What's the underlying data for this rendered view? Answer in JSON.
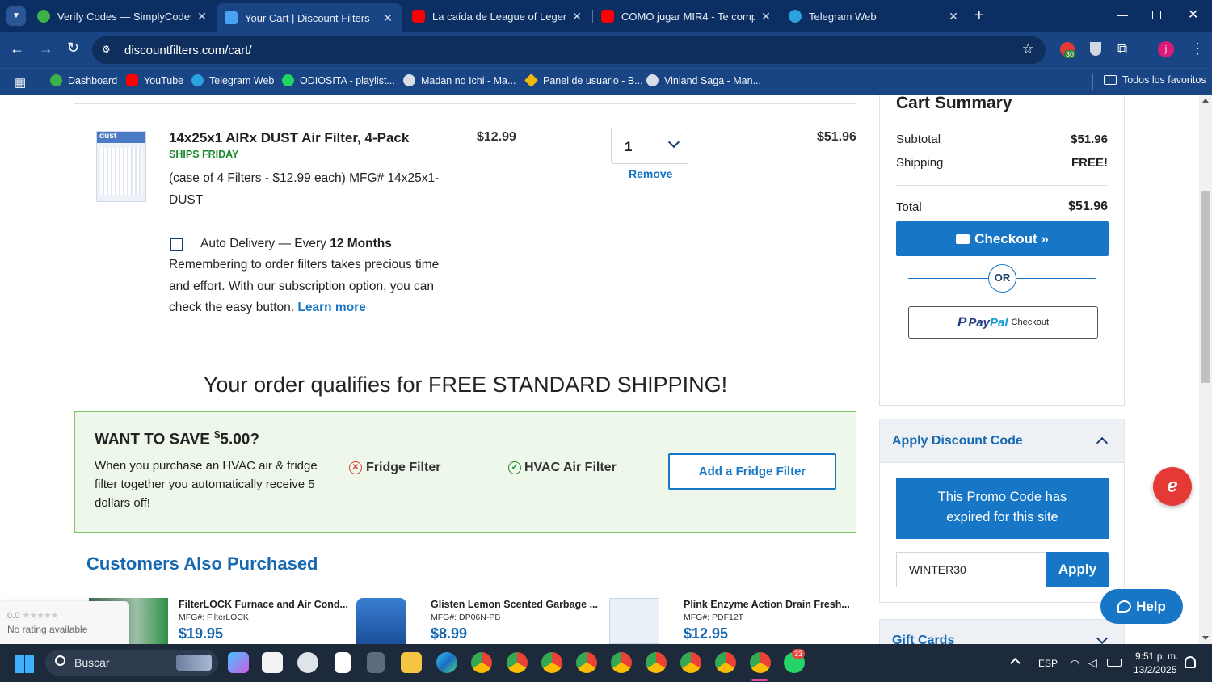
{
  "browser": {
    "tabs": [
      {
        "title": "Verify Codes — SimplyCodes",
        "icon": "simplycodes-icon",
        "color": "#3cb34a"
      },
      {
        "title": "Your Cart | Discount Filters",
        "icon": "discountfilters-icon",
        "color": "#4aa3f0"
      },
      {
        "title": "La caída de League of Legends",
        "icon": "youtube-icon",
        "color": "#ff0000"
      },
      {
        "title": "COMO jugar MIR4 - Te comp",
        "icon": "youtube-icon",
        "color": "#ff0000"
      },
      {
        "title": "Telegram Web",
        "icon": "telegram-icon",
        "color": "#2aa3e0"
      }
    ],
    "url": "discountfilters.com/cart/",
    "extensions_badge": "30",
    "bookmarks": [
      {
        "label": "Dashboard",
        "icon": "simplycodes-icon",
        "color": "#3cb34a"
      },
      {
        "label": "YouTube",
        "icon": "youtube-icon",
        "color": "#ff0000"
      },
      {
        "label": "Telegram Web",
        "icon": "telegram-icon",
        "color": "#2aa3e0"
      },
      {
        "label": "ODIOSITA - playlist...",
        "icon": "spotify-icon",
        "color": "#1ed760"
      },
      {
        "label": "Madan no Ichi - Ma...",
        "icon": "manga-icon",
        "color": "#d8dde6"
      },
      {
        "label": "Panel de usuario - B...",
        "icon": "binance-icon",
        "color": "#f0b90b"
      },
      {
        "label": "Vinland Saga - Man...",
        "icon": "manga-icon",
        "color": "#d8dde6"
      }
    ],
    "all_bookmarks": "Todos los favoritos"
  },
  "cart": {
    "item": {
      "name": "14x25x1 AIRx DUST Air Filter, 4-Pack",
      "ships": "SHIPS FRIDAY",
      "description": "(case of 4 Filters - $12.99 each)  MFG# 14x25x1-DUST",
      "price": "$12.99",
      "quantity": "1",
      "remove": "Remove",
      "line_total": "$51.96",
      "image_label": "dust"
    },
    "auto_delivery": {
      "label_prefix": "Auto Delivery — Every ",
      "label_bold": "12 Months",
      "text": "Remembering to order filters takes precious time and effort. With our subscription option, you can check the easy button.",
      "learn_more": "Learn more"
    },
    "free_shipping": "Your order qualifies for FREE STANDARD SHIPPING!",
    "promo": {
      "title_prefix": "WANT TO SAVE ",
      "title_currency": "$",
      "title_amount": "5.00?",
      "text": "When you purchase an HVAC air & fridge filter together you automatically receive 5 dollars off!",
      "fridge": "Fridge Filter",
      "hvac": "HVAC Air Filter",
      "button": "Add a Fridge Filter"
    },
    "also_purchased_title": "Customers Also Purchased",
    "also_purchased": [
      {
        "name": "FilterLOCK Furnace and Air Cond...",
        "mfg": "MFG#: FilterLOCK",
        "price": "$19.95"
      },
      {
        "name": "Glisten Lemon Scented Garbage ...",
        "mfg": "MFG#: DP06N-PB",
        "price": "$8.99"
      },
      {
        "name": "Plink Enzyme Action Drain Fresh...",
        "mfg": "MFG#: PDF12T",
        "price": "$12.95"
      }
    ],
    "rating": {
      "score": "0.0",
      "text": "No rating available"
    }
  },
  "summary": {
    "title": "Cart Summary",
    "subtotal_label": "Subtotal",
    "subtotal": "$51.96",
    "shipping_label": "Shipping",
    "shipping": "FREE!",
    "total_label": "Total",
    "total": "$51.96",
    "checkout": "Checkout »",
    "or": "OR",
    "paypal_pay": "Pay",
    "paypal_pal": "Pal",
    "paypal_checkout": "Checkout"
  },
  "discount": {
    "title": "Apply Discount Code",
    "message": "This Promo Code has expired for this site",
    "code": "WINTER30",
    "apply": "Apply",
    "gift_cards": "Gift Cards"
  },
  "help_button": "Help",
  "taskbar": {
    "search": "Buscar",
    "lang": "ESP",
    "time": "9:51 p. m.",
    "date": "13/2/2025",
    "whatsapp_badge": "33"
  }
}
